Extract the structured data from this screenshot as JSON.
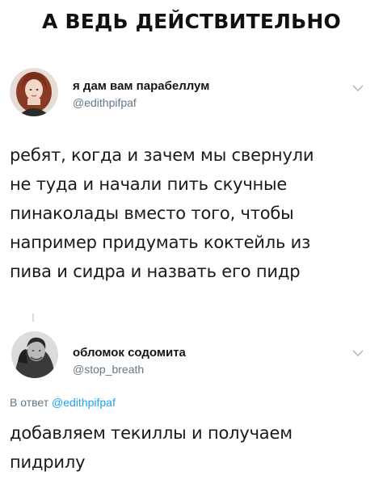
{
  "caption": "А ВЕДЬ ДЕЙСТВИТЕЛЬНО",
  "tweets": [
    {
      "display_name": "я дам вам парабеллум",
      "handle": "@edithpifpaf",
      "avatar_icon": "avatar-photo-woman-red-hair",
      "menu_icon": "chevron-down-icon",
      "text_lines": [
        "ребят, когда и зачем мы свернули",
        "не туда и начали пить скучные",
        "пинаколады вместо того, чтобы",
        "например придумать коктейль из",
        "пива и сидра и назвать его пидр"
      ]
    },
    {
      "display_name": "обломок содомита",
      "handle": "@stop_breath",
      "avatar_icon": "avatar-photo-man-bw",
      "menu_icon": "chevron-down-icon",
      "reply_prefix": "В ответ",
      "reply_mention": "@edithpifpaf",
      "text_lines": [
        "добавляем текиллы и получаем",
        "пидрилу"
      ]
    }
  ],
  "colors": {
    "text": "#14171a",
    "secondary": "#657786",
    "link": "#1da1f2"
  }
}
